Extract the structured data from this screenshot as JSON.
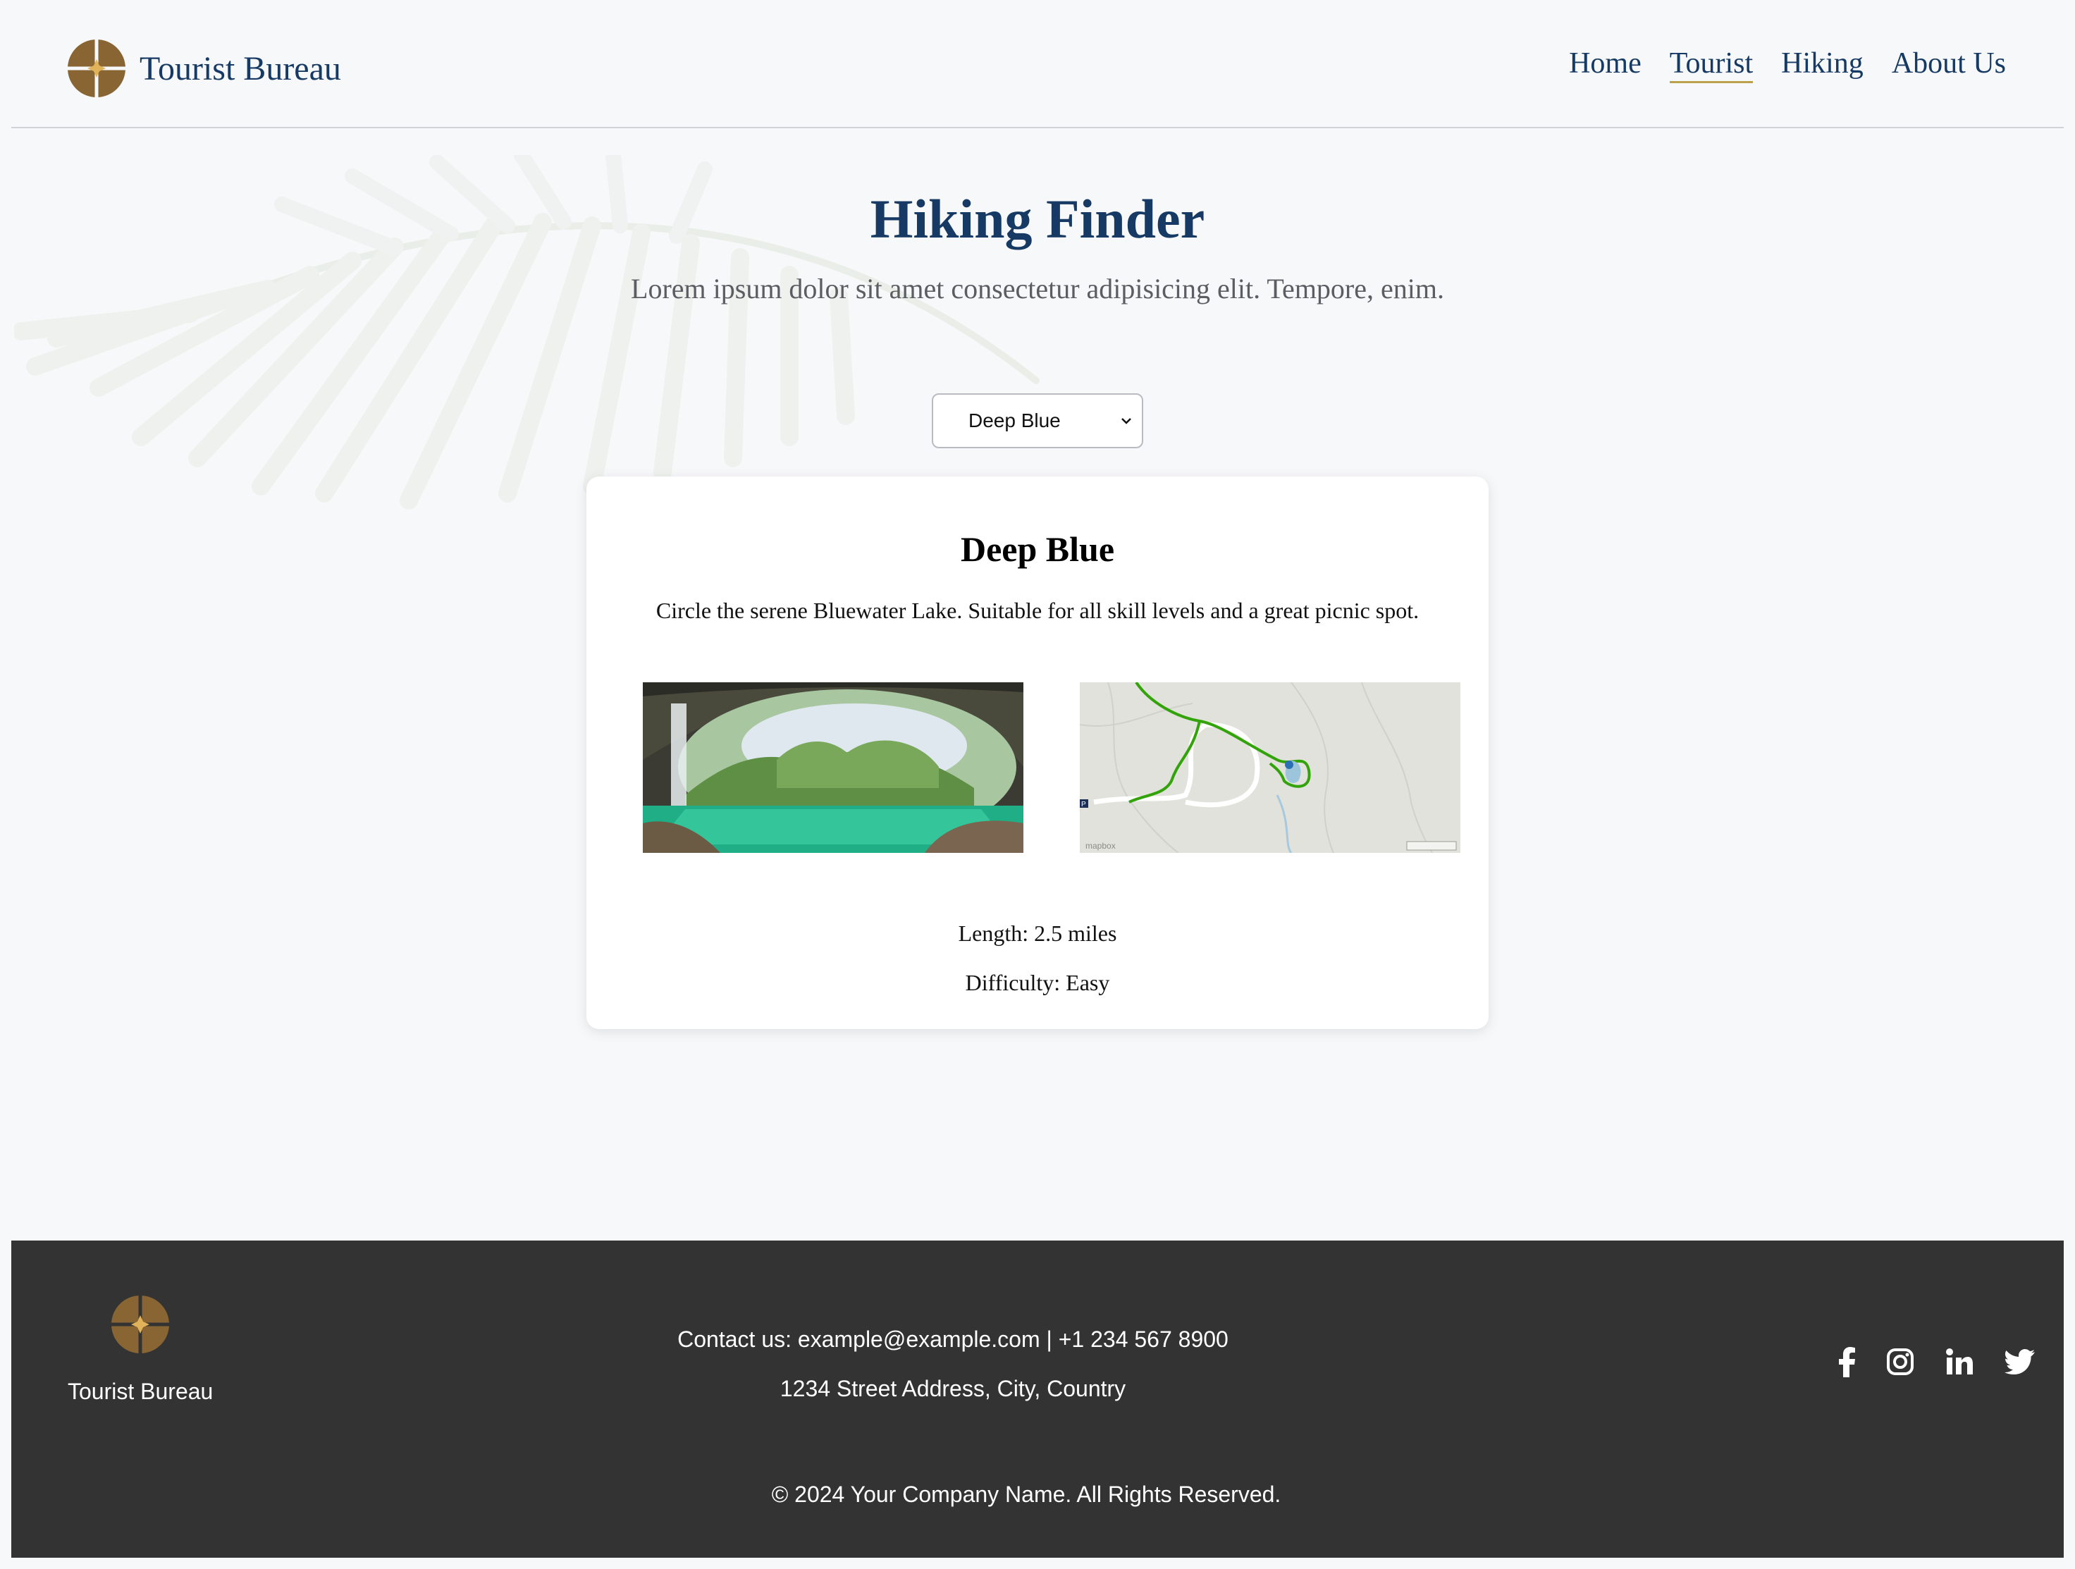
{
  "header": {
    "brand_name": "Tourist Bureau",
    "nav": [
      {
        "label": "Home"
      },
      {
        "label": "Tourist"
      },
      {
        "label": "Hiking"
      },
      {
        "label": "About Us"
      }
    ],
    "active_nav": "Tourist"
  },
  "hero": {
    "title": "Hiking Finder",
    "subtitle": "Lorem ipsum dolor sit amet consectetur adipisicing elit. Tempore, enim."
  },
  "trail_select": {
    "selected": "Deep Blue"
  },
  "card": {
    "title": "Deep Blue",
    "description": "Circle the serene Bluewater Lake. Suitable for all skill levels and a great picnic spot.",
    "length": "Length: 2.5 miles",
    "difficulty": "Difficulty: Easy",
    "map_attribution": "mapbox"
  },
  "footer": {
    "brand_name": "Tourist Bureau",
    "contact": "Contact us: example@example.com | +1 234 567 8900",
    "address": "1234 Street Address, City, Country",
    "copyright": "© 2024 Your Company Name. All Rights Reserved.",
    "social_icons": [
      "facebook-icon",
      "instagram-icon",
      "linkedin-icon",
      "twitter-icon"
    ]
  },
  "colors": {
    "brand_navy": "#163a63",
    "logo_brown": "#8a6534",
    "logo_gold": "#e0b25a",
    "footer_bg": "#333333",
    "page_bg": "#f7f8fa"
  }
}
